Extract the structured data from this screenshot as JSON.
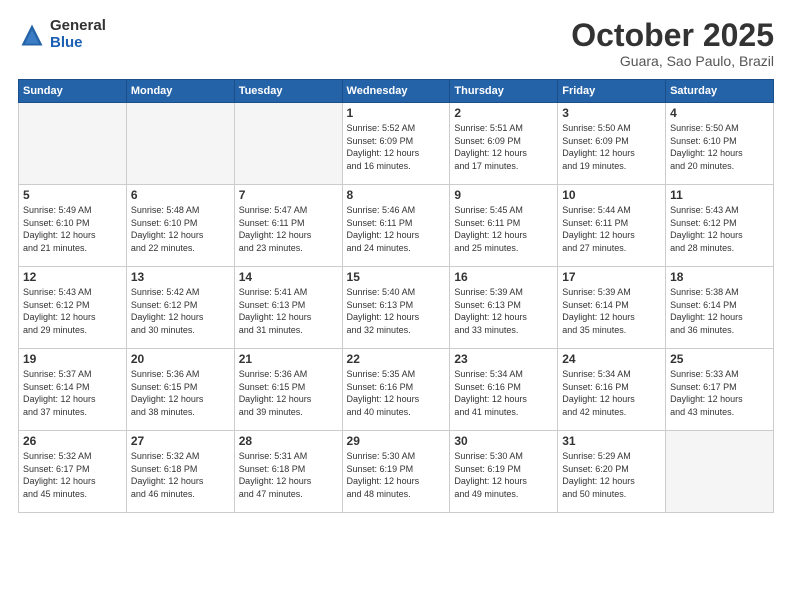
{
  "logo": {
    "general": "General",
    "blue": "Blue"
  },
  "title": "October 2025",
  "subtitle": "Guara, Sao Paulo, Brazil",
  "days_of_week": [
    "Sunday",
    "Monday",
    "Tuesday",
    "Wednesday",
    "Thursday",
    "Friday",
    "Saturday"
  ],
  "weeks": [
    [
      {
        "day": "",
        "info": ""
      },
      {
        "day": "",
        "info": ""
      },
      {
        "day": "",
        "info": ""
      },
      {
        "day": "1",
        "info": "Sunrise: 5:52 AM\nSunset: 6:09 PM\nDaylight: 12 hours\nand 16 minutes."
      },
      {
        "day": "2",
        "info": "Sunrise: 5:51 AM\nSunset: 6:09 PM\nDaylight: 12 hours\nand 17 minutes."
      },
      {
        "day": "3",
        "info": "Sunrise: 5:50 AM\nSunset: 6:09 PM\nDaylight: 12 hours\nand 19 minutes."
      },
      {
        "day": "4",
        "info": "Sunrise: 5:50 AM\nSunset: 6:10 PM\nDaylight: 12 hours\nand 20 minutes."
      }
    ],
    [
      {
        "day": "5",
        "info": "Sunrise: 5:49 AM\nSunset: 6:10 PM\nDaylight: 12 hours\nand 21 minutes."
      },
      {
        "day": "6",
        "info": "Sunrise: 5:48 AM\nSunset: 6:10 PM\nDaylight: 12 hours\nand 22 minutes."
      },
      {
        "day": "7",
        "info": "Sunrise: 5:47 AM\nSunset: 6:11 PM\nDaylight: 12 hours\nand 23 minutes."
      },
      {
        "day": "8",
        "info": "Sunrise: 5:46 AM\nSunset: 6:11 PM\nDaylight: 12 hours\nand 24 minutes."
      },
      {
        "day": "9",
        "info": "Sunrise: 5:45 AM\nSunset: 6:11 PM\nDaylight: 12 hours\nand 25 minutes."
      },
      {
        "day": "10",
        "info": "Sunrise: 5:44 AM\nSunset: 6:11 PM\nDaylight: 12 hours\nand 27 minutes."
      },
      {
        "day": "11",
        "info": "Sunrise: 5:43 AM\nSunset: 6:12 PM\nDaylight: 12 hours\nand 28 minutes."
      }
    ],
    [
      {
        "day": "12",
        "info": "Sunrise: 5:43 AM\nSunset: 6:12 PM\nDaylight: 12 hours\nand 29 minutes."
      },
      {
        "day": "13",
        "info": "Sunrise: 5:42 AM\nSunset: 6:12 PM\nDaylight: 12 hours\nand 30 minutes."
      },
      {
        "day": "14",
        "info": "Sunrise: 5:41 AM\nSunset: 6:13 PM\nDaylight: 12 hours\nand 31 minutes."
      },
      {
        "day": "15",
        "info": "Sunrise: 5:40 AM\nSunset: 6:13 PM\nDaylight: 12 hours\nand 32 minutes."
      },
      {
        "day": "16",
        "info": "Sunrise: 5:39 AM\nSunset: 6:13 PM\nDaylight: 12 hours\nand 33 minutes."
      },
      {
        "day": "17",
        "info": "Sunrise: 5:39 AM\nSunset: 6:14 PM\nDaylight: 12 hours\nand 35 minutes."
      },
      {
        "day": "18",
        "info": "Sunrise: 5:38 AM\nSunset: 6:14 PM\nDaylight: 12 hours\nand 36 minutes."
      }
    ],
    [
      {
        "day": "19",
        "info": "Sunrise: 5:37 AM\nSunset: 6:14 PM\nDaylight: 12 hours\nand 37 minutes."
      },
      {
        "day": "20",
        "info": "Sunrise: 5:36 AM\nSunset: 6:15 PM\nDaylight: 12 hours\nand 38 minutes."
      },
      {
        "day": "21",
        "info": "Sunrise: 5:36 AM\nSunset: 6:15 PM\nDaylight: 12 hours\nand 39 minutes."
      },
      {
        "day": "22",
        "info": "Sunrise: 5:35 AM\nSunset: 6:16 PM\nDaylight: 12 hours\nand 40 minutes."
      },
      {
        "day": "23",
        "info": "Sunrise: 5:34 AM\nSunset: 6:16 PM\nDaylight: 12 hours\nand 41 minutes."
      },
      {
        "day": "24",
        "info": "Sunrise: 5:34 AM\nSunset: 6:16 PM\nDaylight: 12 hours\nand 42 minutes."
      },
      {
        "day": "25",
        "info": "Sunrise: 5:33 AM\nSunset: 6:17 PM\nDaylight: 12 hours\nand 43 minutes."
      }
    ],
    [
      {
        "day": "26",
        "info": "Sunrise: 5:32 AM\nSunset: 6:17 PM\nDaylight: 12 hours\nand 45 minutes."
      },
      {
        "day": "27",
        "info": "Sunrise: 5:32 AM\nSunset: 6:18 PM\nDaylight: 12 hours\nand 46 minutes."
      },
      {
        "day": "28",
        "info": "Sunrise: 5:31 AM\nSunset: 6:18 PM\nDaylight: 12 hours\nand 47 minutes."
      },
      {
        "day": "29",
        "info": "Sunrise: 5:30 AM\nSunset: 6:19 PM\nDaylight: 12 hours\nand 48 minutes."
      },
      {
        "day": "30",
        "info": "Sunrise: 5:30 AM\nSunset: 6:19 PM\nDaylight: 12 hours\nand 49 minutes."
      },
      {
        "day": "31",
        "info": "Sunrise: 5:29 AM\nSunset: 6:20 PM\nDaylight: 12 hours\nand 50 minutes."
      },
      {
        "day": "",
        "info": ""
      }
    ]
  ]
}
